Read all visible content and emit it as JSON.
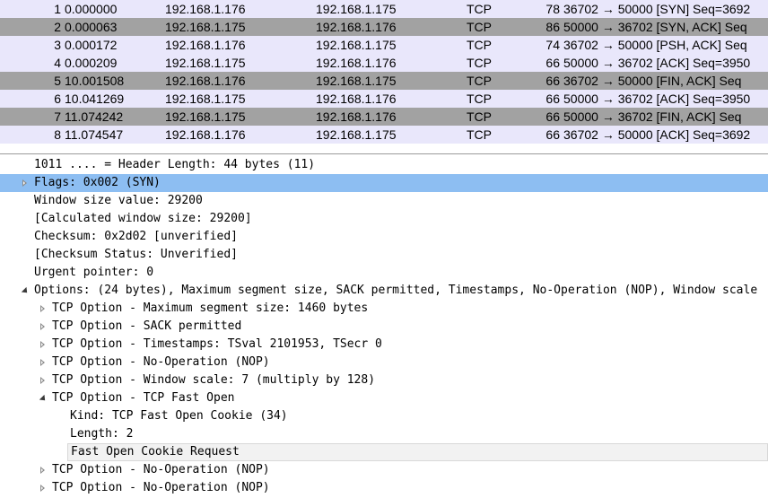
{
  "packet_list": {
    "rows": [
      {
        "no": "1",
        "time": "0.000000",
        "src": "192.168.1.176",
        "dst": "192.168.1.175",
        "proto": "TCP",
        "len": "78",
        "info": "36702 → 50000 [SYN] Seq=3692",
        "shade": "light"
      },
      {
        "no": "2",
        "time": "0.000063",
        "src": "192.168.1.175",
        "dst": "192.168.1.176",
        "proto": "TCP",
        "len": "86",
        "info": "50000 → 36702 [SYN, ACK] Seq",
        "shade": "dark"
      },
      {
        "no": "3",
        "time": "0.000172",
        "src": "192.168.1.176",
        "dst": "192.168.1.175",
        "proto": "TCP",
        "len": "74",
        "info": "36702 → 50000 [PSH, ACK] Seq",
        "shade": "light"
      },
      {
        "no": "4",
        "time": "0.000209",
        "src": "192.168.1.175",
        "dst": "192.168.1.176",
        "proto": "TCP",
        "len": "66",
        "info": "50000 → 36702 [ACK] Seq=3950",
        "shade": "light"
      },
      {
        "no": "5",
        "time": "10.001508",
        "src": "192.168.1.176",
        "dst": "192.168.1.175",
        "proto": "TCP",
        "len": "66",
        "info": "36702 → 50000 [FIN, ACK] Seq",
        "shade": "dark"
      },
      {
        "no": "6",
        "time": "10.041269",
        "src": "192.168.1.175",
        "dst": "192.168.1.176",
        "proto": "TCP",
        "len": "66",
        "info": "50000 → 36702 [ACK] Seq=3950",
        "shade": "light"
      },
      {
        "no": "7",
        "time": "11.074242",
        "src": "192.168.1.175",
        "dst": "192.168.1.176",
        "proto": "TCP",
        "len": "66",
        "info": "50000 → 36702 [FIN, ACK] Seq",
        "shade": "dark"
      },
      {
        "no": "8",
        "time": "11.074547",
        "src": "192.168.1.176",
        "dst": "192.168.1.175",
        "proto": "TCP",
        "len": "66",
        "info": "36702 → 50000 [ACK] Seq=3692",
        "shade": "light"
      }
    ]
  },
  "detail_tree": {
    "rows": [
      {
        "text": "1011 .... = Header Length: 44 bytes (11)",
        "expander": "none",
        "level": 0
      },
      {
        "text": "Flags: 0x002 (SYN)",
        "expander": "collapsed",
        "level": 0,
        "selected": true
      },
      {
        "text": "Window size value: 29200",
        "expander": "none",
        "level": 0
      },
      {
        "text": "[Calculated window size: 29200]",
        "expander": "none",
        "level": 0
      },
      {
        "text": "Checksum: 0x2d02 [unverified]",
        "expander": "none",
        "level": 0
      },
      {
        "text": "[Checksum Status: Unverified]",
        "expander": "none",
        "level": 0
      },
      {
        "text": "Urgent pointer: 0",
        "expander": "none",
        "level": 0
      },
      {
        "text": "Options: (24 bytes), Maximum segment size, SACK permitted, Timestamps, No-Operation (NOP), Window scale",
        "expander": "expanded",
        "level": 0
      },
      {
        "text": "TCP Option - Maximum segment size: 1460 bytes",
        "expander": "collapsed",
        "level": 1
      },
      {
        "text": "TCP Option - SACK permitted",
        "expander": "collapsed",
        "level": 1
      },
      {
        "text": "TCP Option - Timestamps: TSval 2101953, TSecr 0",
        "expander": "collapsed",
        "level": 1
      },
      {
        "text": "TCP Option - No-Operation (NOP)",
        "expander": "collapsed",
        "level": 1
      },
      {
        "text": "TCP Option - Window scale: 7 (multiply by 128)",
        "expander": "collapsed",
        "level": 1
      },
      {
        "text": "TCP Option - TCP Fast Open",
        "expander": "expanded",
        "level": 1
      },
      {
        "text": "Kind: TCP Fast Open Cookie (34)",
        "expander": "none",
        "level": 2
      },
      {
        "text": "Length: 2",
        "expander": "none",
        "level": 2
      },
      {
        "text": "Fast Open Cookie Request",
        "expander": "none",
        "level": 2,
        "hover": true
      },
      {
        "text": "TCP Option - No-Operation (NOP)",
        "expander": "collapsed",
        "level": 1
      },
      {
        "text": "TCP Option - No-Operation (NOP)",
        "expander": "collapsed",
        "level": 1
      }
    ]
  },
  "colors": {
    "row_light": "#e9e7fb",
    "row_dark": "#a2a2a2",
    "selection": "#8dbef2"
  }
}
